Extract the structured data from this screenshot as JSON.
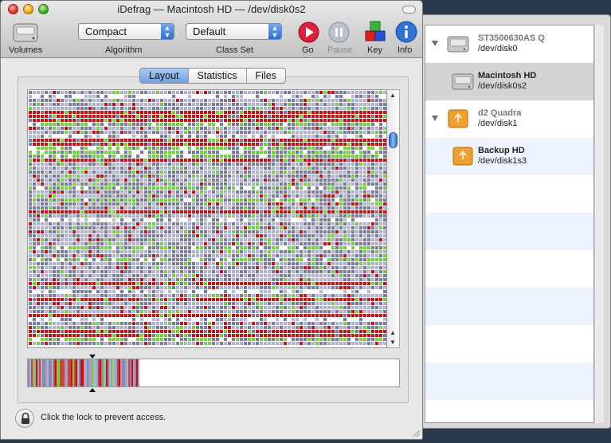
{
  "window": {
    "title": "iDefrag — Macintosh HD — /dev/disk0s2"
  },
  "toolbar": {
    "volumes_label": "Volumes",
    "algorithm_label": "Algorithm",
    "algorithm_value": "Compact",
    "classset_label": "Class Set",
    "classset_value": "Default",
    "go_label": "Go",
    "pause_label": "Pause",
    "key_label": "Key",
    "info_label": "Info"
  },
  "tabs": [
    {
      "label": "Layout",
      "active": true
    },
    {
      "label": "Statistics",
      "active": false
    },
    {
      "label": "Files",
      "active": false
    }
  ],
  "lock": {
    "text": "Click the lock to prevent access."
  },
  "volumes": [
    {
      "name": "ST3500630AS Q",
      "device": "/dev/disk0",
      "kind": "disk"
    },
    {
      "name": "Macintosh HD",
      "device": "/dev/disk0s2",
      "kind": "volume",
      "selected": true
    },
    {
      "name": "d2 Quadra",
      "device": "/dev/disk1",
      "kind": "disk"
    },
    {
      "name": "Backup HD",
      "device": "/dev/disk1s3",
      "kind": "volume"
    }
  ],
  "colors": {
    "fragmented": "#c81010",
    "recent": "#6ed43a",
    "system": "#7a7a9a",
    "free": "#ffffff",
    "accent": "#2f72d6"
  },
  "icons": {
    "volumes": "hard-disk-icon",
    "go": "play-icon",
    "pause": "pause-icon",
    "key": "color-cubes-icon",
    "info": "info-icon",
    "lock": "lock-icon"
  }
}
